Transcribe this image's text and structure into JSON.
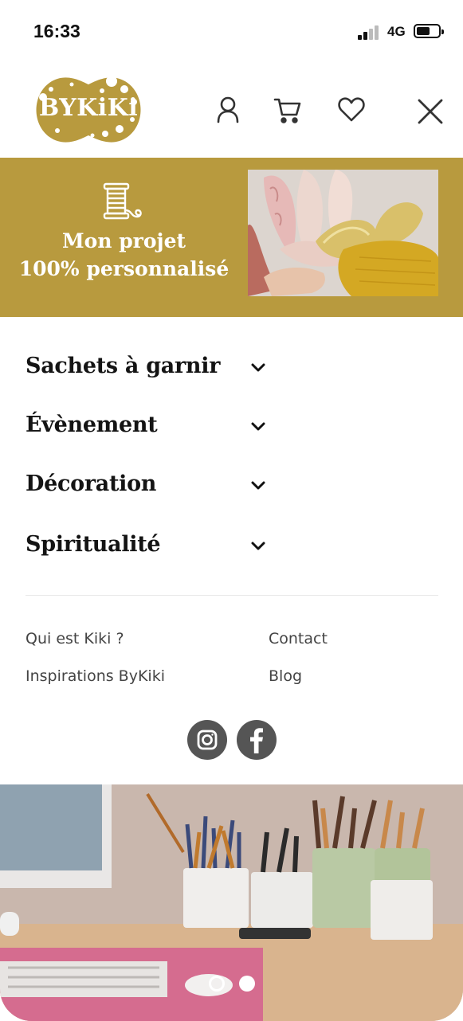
{
  "status_bar": {
    "time": "16:33",
    "network": "4G"
  },
  "header": {
    "logo_text": "BYKiKi",
    "icons": [
      "user-icon",
      "cart-icon",
      "heart-icon",
      "close-icon"
    ]
  },
  "promo": {
    "line1": "Mon projet",
    "line2": "100% personnalisé",
    "icon": "thread-spool-icon",
    "colors": {
      "background": "#b89a3e",
      "text": "#ffffff"
    }
  },
  "menu": {
    "items": [
      {
        "label": "Sachets à garnir"
      },
      {
        "label": "Évènement"
      },
      {
        "label": "Décoration"
      },
      {
        "label": "Spiritualité"
      }
    ]
  },
  "links": {
    "left": [
      "Qui est Kiki ?",
      "Inspirations ByKiki"
    ],
    "right": [
      "Contact",
      "Blog"
    ]
  },
  "social": [
    "instagram-icon",
    "facebook-icon"
  ],
  "carousel": {
    "slides": 2,
    "active": 1
  }
}
